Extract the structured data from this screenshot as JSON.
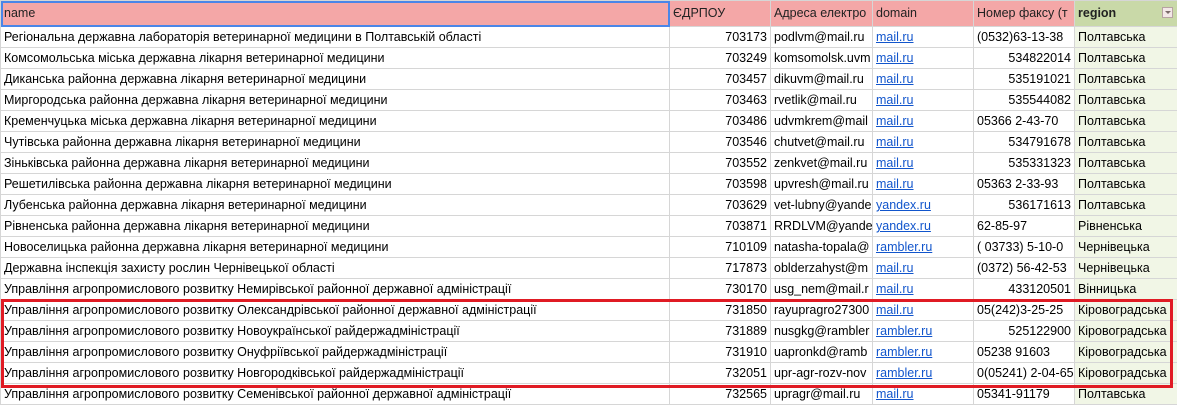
{
  "headers": {
    "name": "name",
    "edrpou": "ЄДРПОУ",
    "email": "Адреса електро",
    "domain": "domain",
    "fax": "Номер факсу (т",
    "region": "region"
  },
  "rows": [
    {
      "name": "Регіональна державна лабораторія ветеринарної медицини в Полтавській області",
      "edrpou": "703173",
      "email": "podlvm@mail.ru",
      "domain": "mail.ru",
      "fax": "(0532)63-13-38",
      "fax_align": "left",
      "region": "Полтавська"
    },
    {
      "name": "Комсомольська міська державна лікарня ветеринарної медицини",
      "edrpou": "703249",
      "email": "komsomolsk.uvm",
      "domain": "mail.ru",
      "fax": "534822014",
      "fax_align": "right",
      "region": "Полтавська"
    },
    {
      "name": "Диканська районна державна лікарня ветеринарної медицини",
      "edrpou": "703457",
      "email": "dikuvm@mail.ru",
      "domain": "mail.ru",
      "fax": "535191021",
      "fax_align": "right",
      "region": "Полтавська"
    },
    {
      "name": "Миргородська районна державна лікарня ветеринарної медицини",
      "edrpou": "703463",
      "email": "rvetlik@mail.ru",
      "domain": "mail.ru",
      "fax": "535544082",
      "fax_align": "right",
      "region": "Полтавська"
    },
    {
      "name": "Кременчуцька міська державна лікарня ветеринарної медицини",
      "edrpou": "703486",
      "email": "udvmkrem@mail",
      "domain": "mail.ru",
      "fax": "05366 2-43-70",
      "fax_align": "left",
      "region": "Полтавська"
    },
    {
      "name": "Чутівська районна державна лікарня ветеринарної медицини",
      "edrpou": "703546",
      "email": "chutvet@mail.ru",
      "domain": "mail.ru",
      "fax": "534791678",
      "fax_align": "right",
      "region": "Полтавська"
    },
    {
      "name": "Зіньківська районна державна лікарня ветеринарної медицини",
      "edrpou": "703552",
      "email": "zenkvet@mail.ru",
      "domain": "mail.ru",
      "fax": "535331323",
      "fax_align": "right",
      "region": "Полтавська"
    },
    {
      "name": "Решетилівська районна державна лікарня ветеринарної медицини",
      "edrpou": "703598",
      "email": "upvresh@mail.ru",
      "domain": "mail.ru",
      "fax": "05363 2-33-93",
      "fax_align": "left",
      "region": "Полтавська"
    },
    {
      "name": "Лубенська районна державна лікарня ветеринарної медицини",
      "edrpou": "703629",
      "email": "vet-lubny@yande",
      "domain": "yandex.ru",
      "fax": "536171613",
      "fax_align": "right",
      "region": "Полтавська"
    },
    {
      "name": "Рівненська районна державна лікарня ветеринарної медицини",
      "edrpou": "703871",
      "email": "RRDLVM@yande",
      "domain": "yandex.ru",
      "fax": "62-85-97",
      "fax_align": "left",
      "region": "Рівненська"
    },
    {
      "name": "Новоселицька  районна  державна  лікарня  ветеринарної  медицини",
      "edrpou": "710109",
      "email": "natasha-topala@",
      "domain": "rambler.ru",
      "fax": "( 03733)   5-10-0",
      "fax_align": "left",
      "region": "Чернівецька"
    },
    {
      "name": "Державна інспекція захисту рослин Чернівецької області",
      "edrpou": "717873",
      "email": "oblderzahyst@m",
      "domain": "mail.ru",
      "fax": "(0372) 56-42-53",
      "fax_align": "left",
      "region": "Чернівецька"
    },
    {
      "name": "Управління агропромислового розвитку Немирівської районної державної адміністрації",
      "edrpou": "730170",
      "email": "usg_nem@mail.r",
      "domain": "mail.ru",
      "fax": "433120501",
      "fax_align": "right",
      "region": "Вінницька"
    },
    {
      "name": "Управління агропромислового розвитку Олександрівської районної державної адміністрації",
      "edrpou": "731850",
      "email": "rayupragro27300",
      "domain": "mail.ru",
      "fax": "05(242)3-25-25",
      "fax_align": "left",
      "region": "Кіровоградська"
    },
    {
      "name": "Управління агропромислового розвитку Новоукраїнської райдержадміністрації",
      "edrpou": "731889",
      "email": "nusgkg@rambler",
      "domain": "rambler.ru",
      "fax": "525122900",
      "fax_align": "right",
      "region": "Кіровоградська"
    },
    {
      "name": "Управління агропромислового розвитку Онуфріївської райдержадміністрації",
      "edrpou": "731910",
      "email": "uapronkd@ramb",
      "domain": "rambler.ru",
      "fax": "05238  91603",
      "fax_align": "left",
      "region": "Кіровоградська"
    },
    {
      "name": "Управління агропромислового розвитку Новгородківської райдержадміністрації",
      "edrpou": "732051",
      "email": "upr-agr-rozv-nov",
      "domain": "rambler.ru",
      "fax": "0(05241) 2-04-65",
      "fax_align": "left",
      "region": "Кіровоградська"
    },
    {
      "name": "Управління агропромислового розвитку Семенівської районної державної адміністрації",
      "edrpou": "732565",
      "email": "upragr@mail.ru",
      "domain": "mail.ru",
      "fax": "05341-91179",
      "fax_align": "left",
      "region": "Полтавська"
    }
  ],
  "colors": {
    "header_bg": "#f4a7a7",
    "region_header_bg": "#c9d9a8",
    "link": "#1155cc",
    "highlight_border": "#e01b24",
    "selection_outline": "#4a86e8"
  },
  "icons": {
    "filter": "filter-dropdown-icon"
  }
}
